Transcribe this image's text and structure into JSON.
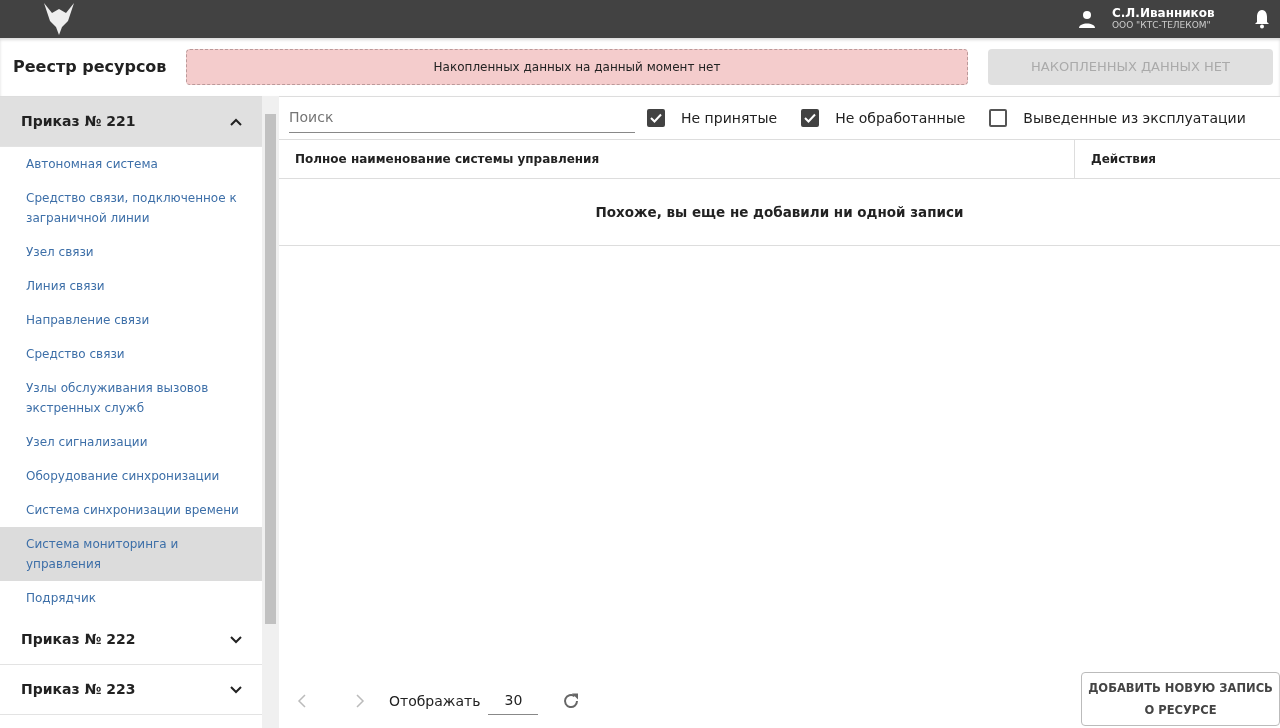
{
  "header": {
    "user_name": "С.Л.Иванников",
    "user_org": "ООО \"КТС-ТЕЛЕКОМ\""
  },
  "page_title": "Реестр ресурсов",
  "alert": "Накопленных данных на данный момент нет",
  "accumulated_button": {
    "label": "НАКОПЛЕННЫХ ДАННЫХ НЕТ",
    "disabled": true
  },
  "sidebar": {
    "groups": [
      {
        "label": "Приказ № 221",
        "expanded": true,
        "children": [
          {
            "label": "Автономная система",
            "selected": false
          },
          {
            "label": "Средство связи, подключенное к заграничной линии",
            "selected": false
          },
          {
            "label": "Узел связи",
            "selected": false
          },
          {
            "label": "Линия связи",
            "selected": false
          },
          {
            "label": "Направление связи",
            "selected": false
          },
          {
            "label": "Средство связи",
            "selected": false
          },
          {
            "label": "Узлы обслуживания вызовов экстренных служб",
            "selected": false
          },
          {
            "label": "Узел сигнализации",
            "selected": false
          },
          {
            "label": "Оборудование синхронизации",
            "selected": false
          },
          {
            "label": "Система синхронизации времени",
            "selected": false
          },
          {
            "label": "Система мониторинга и управления",
            "selected": true
          },
          {
            "label": "Подрядчик",
            "selected": false
          }
        ]
      },
      {
        "label": "Приказ № 222",
        "expanded": false
      },
      {
        "label": "Приказ № 223",
        "expanded": false
      }
    ]
  },
  "search": {
    "placeholder": "Поиск"
  },
  "filters": [
    {
      "label": "Не принятые",
      "checked": true
    },
    {
      "label": "Не обработанные",
      "checked": true
    },
    {
      "label": "Выведенные из эксплуатации",
      "checked": false
    }
  ],
  "table": {
    "columns": [
      "Полное наименование системы управления",
      "Действия"
    ],
    "empty_message": "Похоже, вы еще не добавили ни одной записи"
  },
  "pagination": {
    "page_size_label": "Отображать",
    "page_size": "30"
  },
  "add_button": "ДОБАВИТЬ НОВУЮ ЗАПИСЬ О РЕСУРСЕ"
}
